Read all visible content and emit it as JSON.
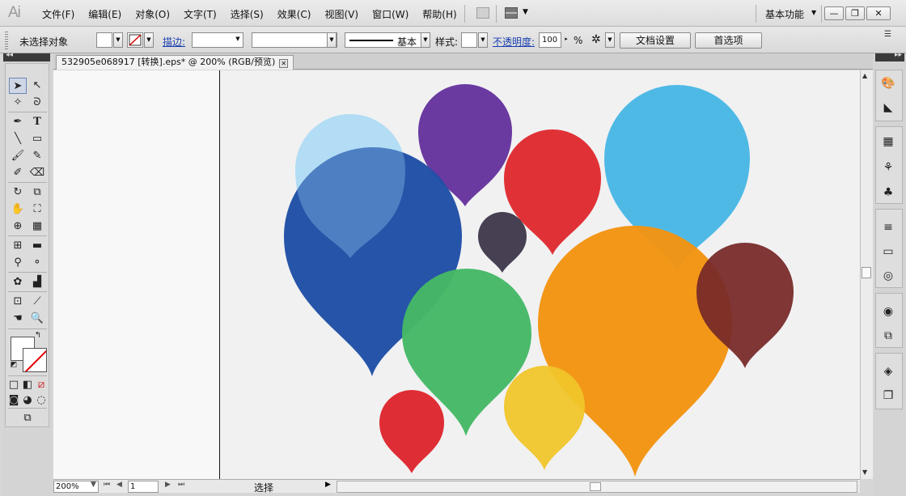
{
  "app": {
    "logo": "Ai",
    "menu": [
      "文件(F)",
      "编辑(E)",
      "对象(O)",
      "文字(T)",
      "选择(S)",
      "效果(C)",
      "视图(V)",
      "窗口(W)",
      "帮助(H)"
    ],
    "workspace_label": "基本功能",
    "window_buttons": {
      "minimize": "—",
      "restore": "❐",
      "close": "✕"
    }
  },
  "control_bar": {
    "selection_status": "未选择对象",
    "stroke_label": "描边:",
    "stroke_profile": "基本",
    "style_label": "样式:",
    "opacity_label": "不透明度:",
    "opacity_value": "100",
    "opacity_unit": "%",
    "doc_setup_button": "文档设置",
    "prefs_button": "首选项"
  },
  "document": {
    "tab_title": "532905e068917 [转换].eps* @ 200% (RGB/预览)",
    "tab_close": "✕"
  },
  "status_bar": {
    "zoom": "200%",
    "page": "1",
    "tool_status": "选择"
  },
  "tools": [
    "selection-tool",
    "direct-selection-tool",
    "magic-wand-tool",
    "lasso-tool",
    "pen-tool",
    "type-tool",
    "line-tool",
    "rectangle-tool",
    "paintbrush-tool",
    "pencil-tool",
    "blob-brush-tool",
    "eraser-tool",
    "rotate-tool",
    "scale-tool",
    "warp-tool",
    "free-transform-tool",
    "shape-builder-tool",
    "perspective-grid-tool",
    "mesh-tool",
    "gradient-tool",
    "eyedropper-tool",
    "blend-tool",
    "symbol-sprayer-tool",
    "column-graph-tool",
    "artboard-tool",
    "slice-tool",
    "hand-tool",
    "zoom-tool"
  ],
  "right_panels": [
    "color-icon",
    "color-guide-icon",
    "swatches-icon",
    "brushes-icon",
    "symbols-icon",
    "stroke-icon",
    "gradient-icon",
    "transparency-icon",
    "appearance-icon",
    "graphic-styles-icon",
    "layers-icon",
    "artboards-icon"
  ],
  "artwork": {
    "balloons": [
      {
        "color": "#b9e1f6",
        "name": "light-blue"
      },
      {
        "color": "#6a3aa0",
        "name": "purple"
      },
      {
        "color": "#e03236",
        "name": "red"
      },
      {
        "color": "#4fb9e6",
        "name": "sky-blue"
      },
      {
        "color": "#1f4ea6",
        "name": "navy-blue"
      },
      {
        "color": "#474052",
        "name": "dark-slate"
      },
      {
        "color": "#45b966",
        "name": "green"
      },
      {
        "color": "#f39412",
        "name": "orange"
      },
      {
        "color": "#772928",
        "name": "maroon"
      },
      {
        "color": "#f0c52a",
        "name": "yellow"
      },
      {
        "color": "#df2d35",
        "name": "small-red"
      }
    ]
  }
}
